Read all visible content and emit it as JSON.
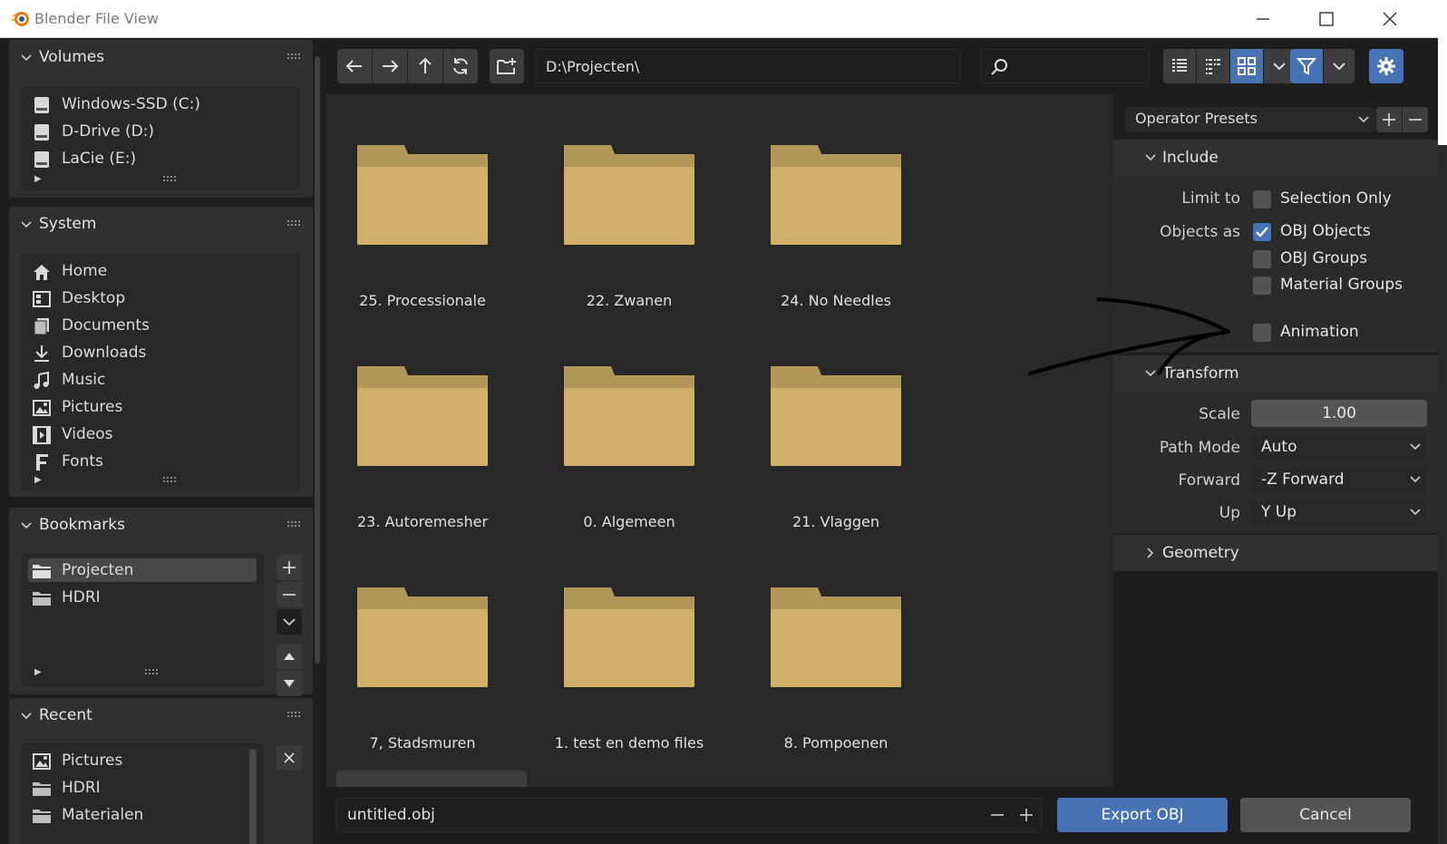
{
  "window": {
    "title": "Blender File View"
  },
  "sidebar": {
    "volumes": {
      "title": "Volumes",
      "items": [
        {
          "label": "Windows-SSD (C:)",
          "icon": "drive-icon"
        },
        {
          "label": "D-Drive (D:)",
          "icon": "drive-icon"
        },
        {
          "label": "LaCie (E:)",
          "icon": "drive-icon"
        }
      ]
    },
    "system": {
      "title": "System",
      "items": [
        {
          "label": "Home",
          "icon": "home-icon"
        },
        {
          "label": "Desktop",
          "icon": "desktop-icon"
        },
        {
          "label": "Documents",
          "icon": "documents-icon"
        },
        {
          "label": "Downloads",
          "icon": "downloads-icon"
        },
        {
          "label": "Music",
          "icon": "music-icon"
        },
        {
          "label": "Pictures",
          "icon": "pictures-icon"
        },
        {
          "label": "Videos",
          "icon": "videos-icon"
        },
        {
          "label": "Fonts",
          "icon": "fonts-icon"
        }
      ]
    },
    "bookmarks": {
      "title": "Bookmarks",
      "items": [
        {
          "label": "Projecten",
          "icon": "folder-icon",
          "selected": true
        },
        {
          "label": "HDRI",
          "icon": "folder-icon",
          "selected": false
        }
      ]
    },
    "recent": {
      "title": "Recent",
      "items": [
        {
          "label": "Pictures",
          "icon": "pictures-icon"
        },
        {
          "label": "HDRI",
          "icon": "folder-icon"
        },
        {
          "label": "Materialen",
          "icon": "folder-icon"
        }
      ]
    }
  },
  "toolbar": {
    "path": "D:\\Projecten\\",
    "search_placeholder": "",
    "view_mode": "thumbnails"
  },
  "files": [
    {
      "name": "25. Processionale"
    },
    {
      "name": "22. Zwanen"
    },
    {
      "name": "24. No Needles"
    },
    {
      "name": "23. Autoremesher"
    },
    {
      "name": "0. Algemeen"
    },
    {
      "name": "21. Vlaggen"
    },
    {
      "name": "7, Stadsmuren"
    },
    {
      "name": "1. test en demo files"
    },
    {
      "name": "8. Pompoenen"
    }
  ],
  "properties": {
    "operator_presets": "Operator Presets",
    "include": {
      "title": "Include",
      "limit_to_label": "Limit to",
      "selection_only": {
        "label": "Selection Only",
        "checked": false
      },
      "objects_as_label": "Objects as",
      "obj_objects": {
        "label": "OBJ Objects",
        "checked": true
      },
      "obj_groups": {
        "label": "OBJ Groups",
        "checked": false
      },
      "material_groups": {
        "label": "Material Groups",
        "checked": false
      },
      "animation": {
        "label": "Animation",
        "checked": false
      }
    },
    "transform": {
      "title": "Transform",
      "scale_label": "Scale",
      "scale_value": "1.00",
      "path_mode_label": "Path Mode",
      "path_mode_value": "Auto",
      "forward_label": "Forward",
      "forward_value": "-Z Forward",
      "up_label": "Up",
      "up_value": "Y Up"
    },
    "geometry": {
      "title": "Geometry"
    }
  },
  "bottom": {
    "filename": "untitled.obj",
    "export_label": "Export OBJ",
    "cancel_label": "Cancel"
  },
  "colors": {
    "accent": "#4772b3",
    "folder": "#d1b06a",
    "folder_tab": "#b2965a"
  }
}
